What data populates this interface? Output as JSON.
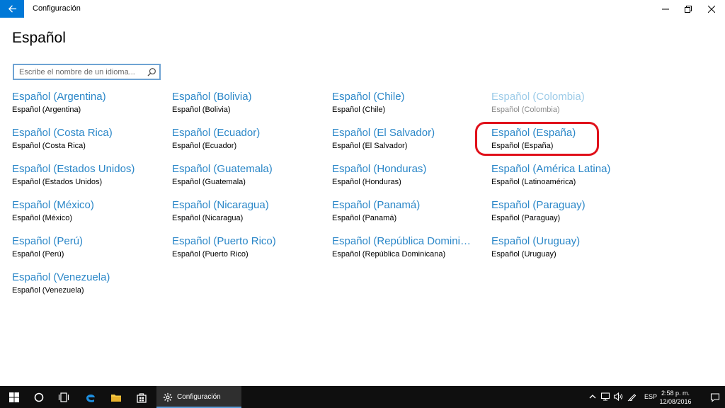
{
  "window": {
    "title": "Configuración",
    "minimize_symbol": "minimize-icon",
    "maximize_symbol": "restore-icon",
    "close_symbol": "close-icon"
  },
  "page": {
    "title": "Español"
  },
  "search": {
    "placeholder": "Escribe el nombre de un idioma..."
  },
  "languages": [
    {
      "name": "Español (Argentina)",
      "sub": "Español (Argentina)",
      "disabled": false
    },
    {
      "name": "Español (Bolivia)",
      "sub": "Español (Bolivia)",
      "disabled": false
    },
    {
      "name": "Español (Chile)",
      "sub": "Español (Chile)",
      "disabled": false
    },
    {
      "name": "Español (Colombia)",
      "sub": "Español (Colombia)",
      "disabled": true
    },
    {
      "name": "Español (Costa Rica)",
      "sub": "Español (Costa Rica)",
      "disabled": false
    },
    {
      "name": "Español (Ecuador)",
      "sub": "Español (Ecuador)",
      "disabled": false
    },
    {
      "name": "Español (El Salvador)",
      "sub": "Español (El Salvador)",
      "disabled": false
    },
    {
      "name": "Español (España)",
      "sub": "Español (España)",
      "disabled": false
    },
    {
      "name": "Español (Estados Unidos)",
      "sub": "Español (Estados Unidos)",
      "disabled": false
    },
    {
      "name": "Español (Guatemala)",
      "sub": "Español (Guatemala)",
      "disabled": false
    },
    {
      "name": "Español (Honduras)",
      "sub": "Español (Honduras)",
      "disabled": false
    },
    {
      "name": "Español (América Latina)",
      "sub": "Español (Latinoamérica)",
      "disabled": false
    },
    {
      "name": "Español (México)",
      "sub": "Español (México)",
      "disabled": false
    },
    {
      "name": "Español (Nicaragua)",
      "sub": "Español (Nicaragua)",
      "disabled": false
    },
    {
      "name": "Español (Panamá)",
      "sub": "Español (Panamá)",
      "disabled": false
    },
    {
      "name": "Español (Paraguay)",
      "sub": "Español (Paraguay)",
      "disabled": false
    },
    {
      "name": "Español (Perú)",
      "sub": "Español (Perú)",
      "disabled": false
    },
    {
      "name": "Español (Puerto Rico)",
      "sub": "Español (Puerto Rico)",
      "disabled": false
    },
    {
      "name": "Español (República Dominicana)",
      "sub": "Español (República Dominicana)",
      "disabled": false
    },
    {
      "name": "Español (Uruguay)",
      "sub": "Español (Uruguay)",
      "disabled": false
    },
    {
      "name": "Español (Venezuela)",
      "sub": "Español (Venezuela)",
      "disabled": false
    }
  ],
  "taskbar": {
    "active_app_label": "Configuración",
    "language": "ESP",
    "time": "2:58 p. m.",
    "date": "12/08/2016"
  },
  "colors": {
    "accent": "#0078d7",
    "link": "#2b87c8",
    "link_disabled": "#9ccbe8",
    "highlight": "#e0101a",
    "taskbar": "#0f0f0f"
  }
}
